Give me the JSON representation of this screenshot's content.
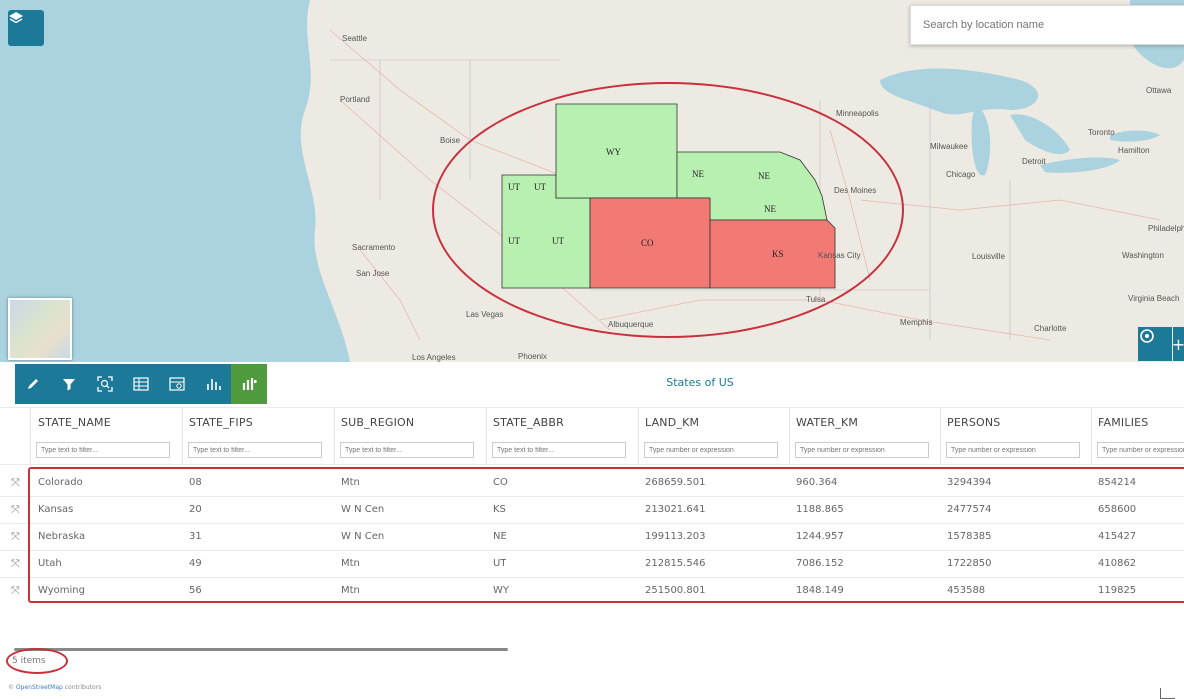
{
  "map": {
    "search_placeholder": "Search by location name",
    "cities": [
      "Seattle",
      "Portland",
      "Boise",
      "Sacramento",
      "San Jose",
      "Las Vegas",
      "Los Angeles",
      "Phoenix",
      "Albuquerque",
      "Tulsa",
      "Kansas City",
      "Des Moines",
      "Minneapolis",
      "Milwaukee",
      "Chicago",
      "Detroit",
      "Toronto",
      "Ottawa",
      "Louisville",
      "Memphis",
      "Charlotte",
      "Washington",
      "Philadelphia",
      "Virginia Beach",
      "Hamilton"
    ],
    "state_labels": {
      "wy": "WY",
      "ut_a": "UT",
      "ut_b": "UT",
      "ut_c": "UT",
      "ut_d": "UT",
      "co": "CO",
      "ne_a": "NE",
      "ne_b": "NE",
      "ne_c": "NE",
      "ks": "KS"
    },
    "colors": {
      "selected_fill": "#b7f0b1",
      "highlight_fill": "#f27a75",
      "annotation": "#c8303b",
      "water": "#aad3df"
    }
  },
  "toolbar": {
    "icons": [
      "pencil-icon",
      "filter-icon",
      "zoom-to-selection-icon",
      "table-add-icon",
      "table-settings-icon",
      "bar-chart-icon",
      "widgets-icon"
    ],
    "accent": "#1c7a98",
    "green": "#4e9a3c"
  },
  "grid": {
    "title": "States of US",
    "columns": [
      "STATE_NAME",
      "STATE_FIPS",
      "SUB_REGION",
      "STATE_ABBR",
      "LAND_KM",
      "WATER_KM",
      "PERSONS",
      "FAMILIES"
    ],
    "filter_placeholders": [
      "Type text to filter...",
      "Type text to filter...",
      "Type text to filter...",
      "Type text to filter...",
      "Type number or expression",
      "Type number or expression",
      "Type number or expression",
      "Type number or expression"
    ],
    "rows": [
      [
        "Colorado",
        "08",
        "Mtn",
        "CO",
        "268659.501",
        "960.364",
        "3294394",
        "854214"
      ],
      [
        "Kansas",
        "20",
        "W N Cen",
        "KS",
        "213021.641",
        "1188.865",
        "2477574",
        "658600"
      ],
      [
        "Nebraska",
        "31",
        "W N Cen",
        "NE",
        "199113.203",
        "1244.957",
        "1578385",
        "415427"
      ],
      [
        "Utah",
        "49",
        "Mtn",
        "UT",
        "212815.546",
        "7086.152",
        "1722850",
        "410862"
      ],
      [
        "Wyoming",
        "56",
        "Mtn",
        "WY",
        "251500.801",
        "1848.149",
        "453588",
        "119825"
      ]
    ],
    "footer": "5 items"
  },
  "attribution": {
    "prefix": "© ",
    "link": "OpenStreetMap",
    "suffix": " contributors"
  }
}
